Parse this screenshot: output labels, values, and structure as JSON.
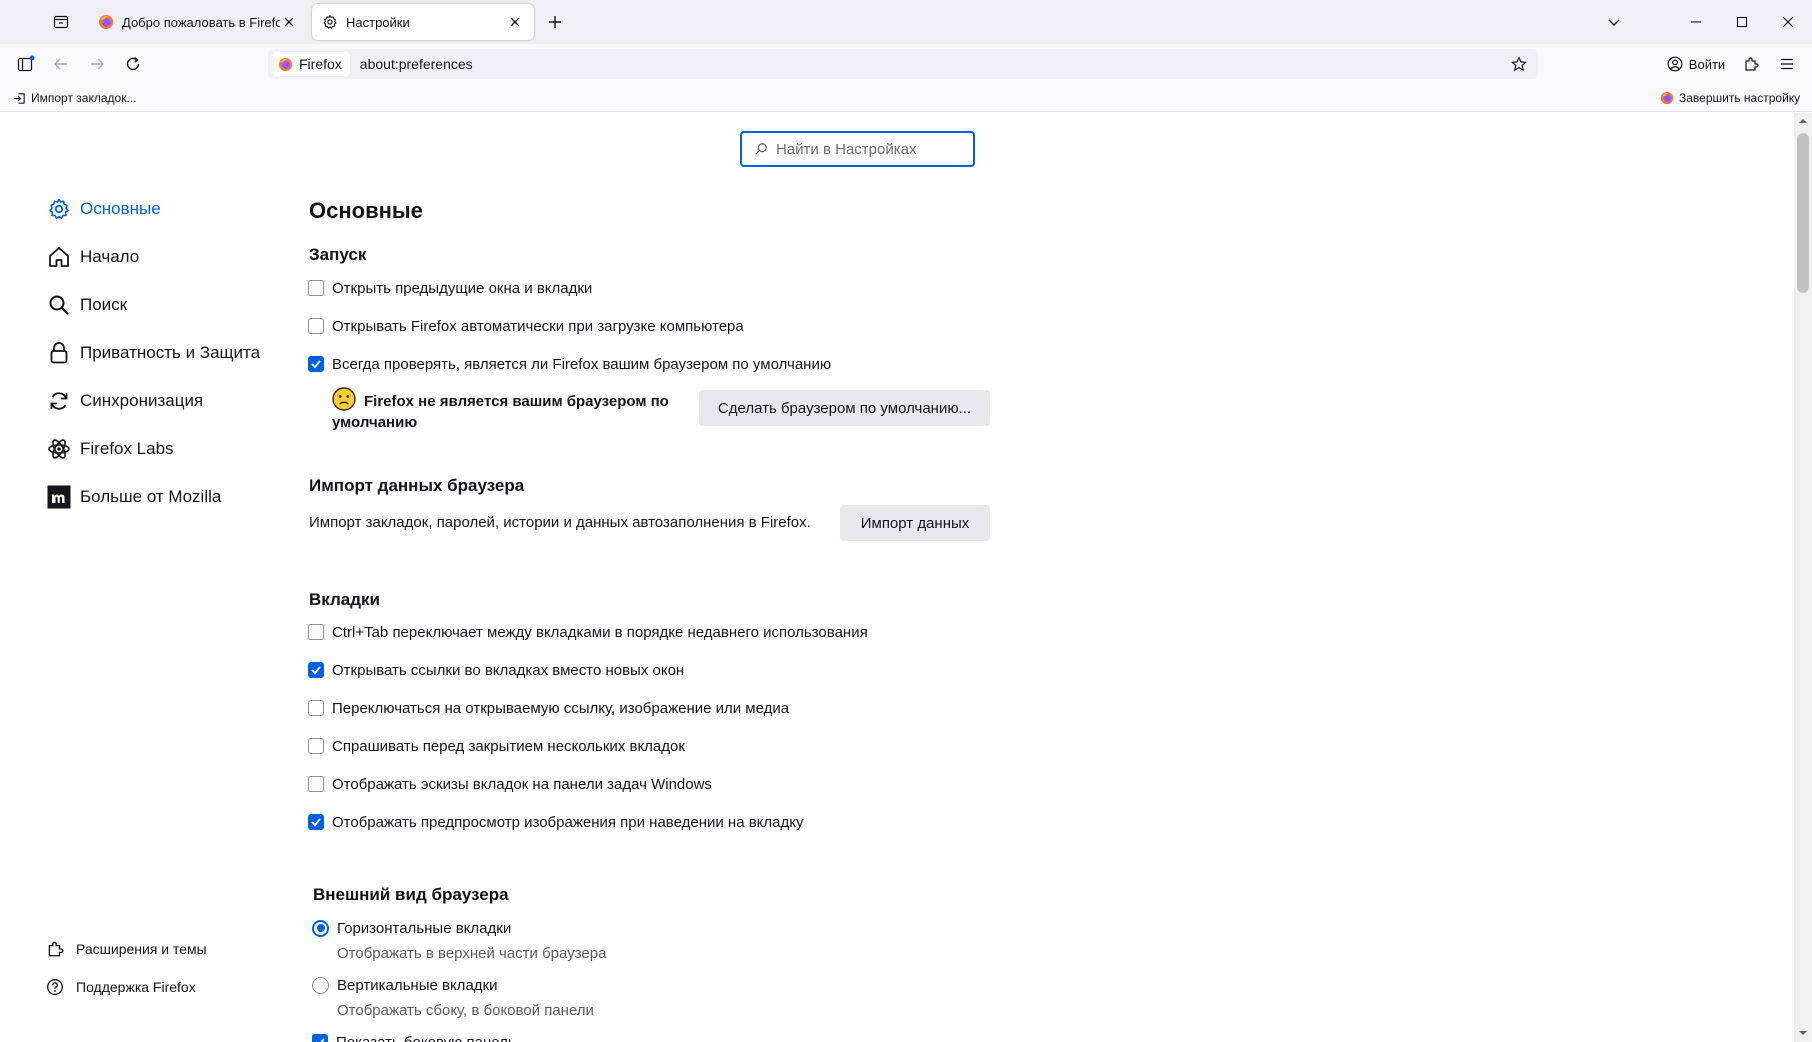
{
  "tabs": [
    {
      "title": "Добро пожаловать в Firefox",
      "active": false
    },
    {
      "title": "Настройки",
      "active": true
    }
  ],
  "navbar": {
    "identity_label": "Firefox",
    "url": "about:preferences",
    "signin_label": "Войти"
  },
  "bookmarks": {
    "import_label": "Импорт закладок...",
    "finish_setup_label": "Завершить настройку"
  },
  "search": {
    "placeholder": "Найти в Настройках"
  },
  "sidebar": {
    "categories": [
      {
        "label": "Основные",
        "icon": "gear-icon",
        "selected": true
      },
      {
        "label": "Начало",
        "icon": "home-icon"
      },
      {
        "label": "Поиск",
        "icon": "search-icon"
      },
      {
        "label": "Приватность и Защита",
        "icon": "lock-icon"
      },
      {
        "label": "Синхронизация",
        "icon": "sync-icon"
      },
      {
        "label": "Firefox Labs",
        "icon": "labs-icon"
      },
      {
        "label": "Больше от Mozilla",
        "icon": "mozilla-icon"
      }
    ],
    "footer": [
      {
        "label": "Расширения и темы",
        "icon": "puzzle-icon"
      },
      {
        "label": "Поддержка Firefox",
        "icon": "help-icon"
      }
    ]
  },
  "main": {
    "title": "Основные",
    "startup": {
      "heading": "Запуск",
      "options": [
        {
          "label": "Открыть предыдущие окна и вкладки",
          "checked": false
        },
        {
          "label": "Открывать Firefox автоматически при загрузке компьютера",
          "checked": false
        },
        {
          "label": "Всегда проверять, является ли Firefox вашим браузером по умолчанию",
          "checked": true
        }
      ],
      "default_message": "Firefox не является вашим браузером по умолчанию",
      "default_button": "Сделать браузером по умолчанию..."
    },
    "import": {
      "heading": "Импорт данных браузера",
      "description": "Импорт закладок, паролей, истории и данных автозаполнения в Firefox.",
      "button": "Импорт данных"
    },
    "tabs_section": {
      "heading": "Вкладки",
      "options": [
        {
          "label": "Ctrl+Tab переключает между вкладками в порядке недавнего использования",
          "checked": false
        },
        {
          "label": "Открывать ссылки во вкладках вместо новых окон",
          "checked": true
        },
        {
          "label": "Переключаться на открываемую ссылку, изображение или медиа",
          "checked": false
        },
        {
          "label": "Спрашивать перед закрытием нескольких вкладок",
          "checked": false
        },
        {
          "label": "Отображать эскизы вкладок на панели задач Windows",
          "checked": false
        },
        {
          "label": "Отображать предпросмотр изображения при наведении на вкладку",
          "checked": true
        }
      ]
    },
    "appearance": {
      "heading": "Внешний вид браузера",
      "options": [
        {
          "label": "Горизонтальные вкладки",
          "description": "Отображать в верхней части браузера",
          "selected": true
        },
        {
          "label": "Вертикальные вкладки",
          "description": "Отображать сбоку, в боковой панели",
          "selected": false
        }
      ],
      "partial_option": {
        "label": "Показать боковую панель",
        "checked": true
      }
    }
  },
  "colors": {
    "accent": "#0061e0",
    "toolbar": "#f9f9fb",
    "tabstrip": "#f0f0f4"
  }
}
